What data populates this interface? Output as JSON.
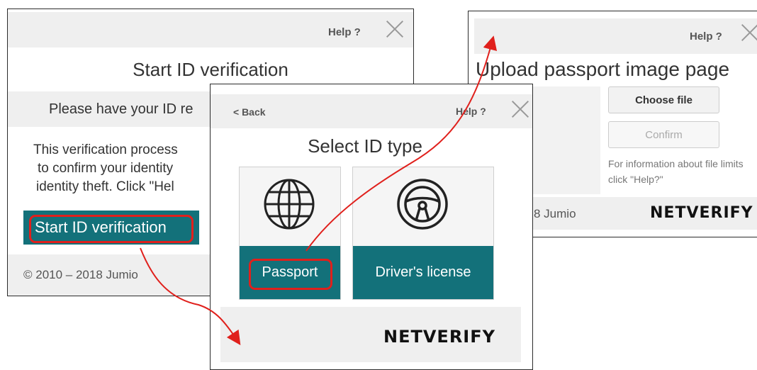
{
  "window1": {
    "help": "Help ?",
    "title": "Start ID verification",
    "notice": "Please have your ID re",
    "body_lines": [
      "This verification process",
      "to confirm your identity",
      "identity theft. Click \"Hel"
    ],
    "start_button": "Start ID verification",
    "copyright": "© 2010 – 2018 Jumio"
  },
  "window2": {
    "back": "< Back",
    "help": "Help ?",
    "title": "Select ID type",
    "options": [
      {
        "label": "Passport",
        "icon": "globe-icon"
      },
      {
        "label": "Driver's license",
        "icon": "steering-wheel-icon"
      }
    ],
    "brand": "NETVERIFY"
  },
  "window3": {
    "help": "Help ?",
    "title": "Upload passport image page",
    "choose_file": "Choose file",
    "confirm": "Confirm",
    "info": "For information about file limits click \"Help?\"",
    "footer_partial": "8 Jumio",
    "brand": "NETVERIFY"
  },
  "colors": {
    "accent": "#13717a",
    "highlight": "#e0201c",
    "bar": "#efefef"
  }
}
